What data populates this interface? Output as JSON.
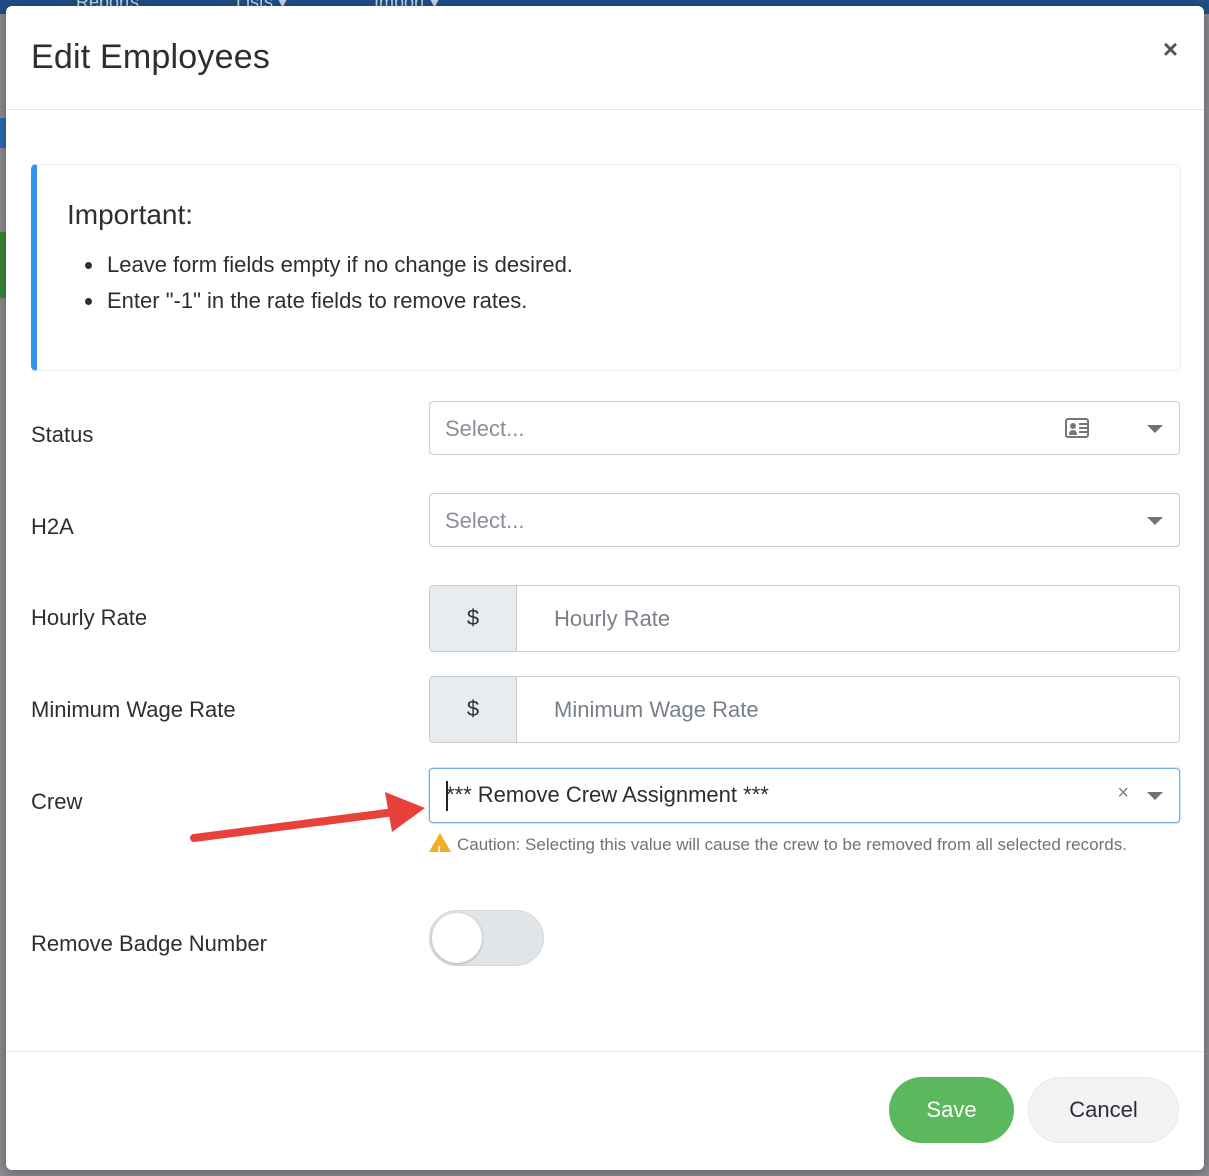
{
  "backdrop": {
    "menu_items": [
      "Reports",
      "Lists ▾",
      "Import ▾"
    ]
  },
  "modal": {
    "title": "Edit Employees",
    "close_glyph": "×"
  },
  "notice": {
    "title": "Important:",
    "items": [
      "Leave form fields empty if no change is desired.",
      "Enter \"-1\" in the rate fields to remove rates."
    ],
    "accent_color": "#2f93f0"
  },
  "form": {
    "status": {
      "label": "Status",
      "placeholder": "Select...",
      "icon": "id-card-icon"
    },
    "h2a": {
      "label": "H2A",
      "placeholder": "Select..."
    },
    "hourly_rate": {
      "label": "Hourly Rate",
      "addon": "$",
      "placeholder": "Hourly Rate"
    },
    "minimum_wage_rate": {
      "label": "Minimum Wage Rate",
      "addon": "$",
      "placeholder": "Minimum Wage Rate"
    },
    "crew": {
      "label": "Crew",
      "value": "*** Remove Crew Assignment ***",
      "clear_glyph": "×",
      "caution": "Caution: Selecting this value will cause the crew to be removed from all selected records."
    },
    "remove_badge_number": {
      "label": "Remove Badge Number",
      "checked": false
    }
  },
  "footer": {
    "save_label": "Save",
    "cancel_label": "Cancel",
    "save_color": "#5cb85c"
  },
  "annotation": {
    "arrow_color": "#e8403a"
  }
}
